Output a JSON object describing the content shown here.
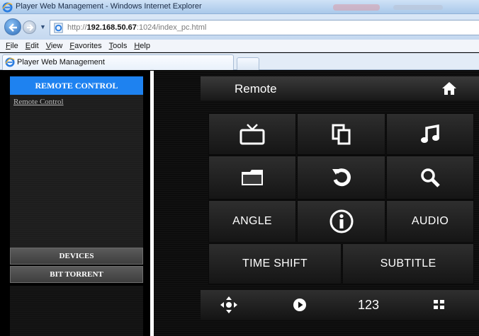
{
  "browser": {
    "window_title": "Player Web Management - Windows Internet Explorer",
    "url_prefix": "http://",
    "url_host": "192.168.50.67",
    "url_rest": ":1024/index_pc.html",
    "menu": [
      "File",
      "Edit",
      "View",
      "Favorites",
      "Tools",
      "Help"
    ],
    "tab_label": "Player Web Management"
  },
  "sidebar": {
    "header": "REMOTE CONTROL",
    "link": "Remote Control",
    "sections": [
      "DEVICES",
      "BIT TORRENT"
    ]
  },
  "remote": {
    "title": "Remote",
    "icons": {
      "home": "home-icon",
      "tv": "tv-icon",
      "copy": "copy-icon",
      "music": "music-icon",
      "folder": "folder-icon",
      "refresh": "refresh-icon",
      "search": "search-icon",
      "info": "info-icon",
      "dpad": "dpad-icon",
      "play": "play-icon",
      "grid": "grid-icon"
    },
    "angle_label": "ANGLE",
    "audio_label": "AUDIO",
    "time_shift_label": "TIME SHIFT",
    "subtitle_label": "SUBTITLE",
    "numpad_label": "123"
  },
  "colors": {
    "accent": "#1e82f0",
    "background": "#000000"
  }
}
